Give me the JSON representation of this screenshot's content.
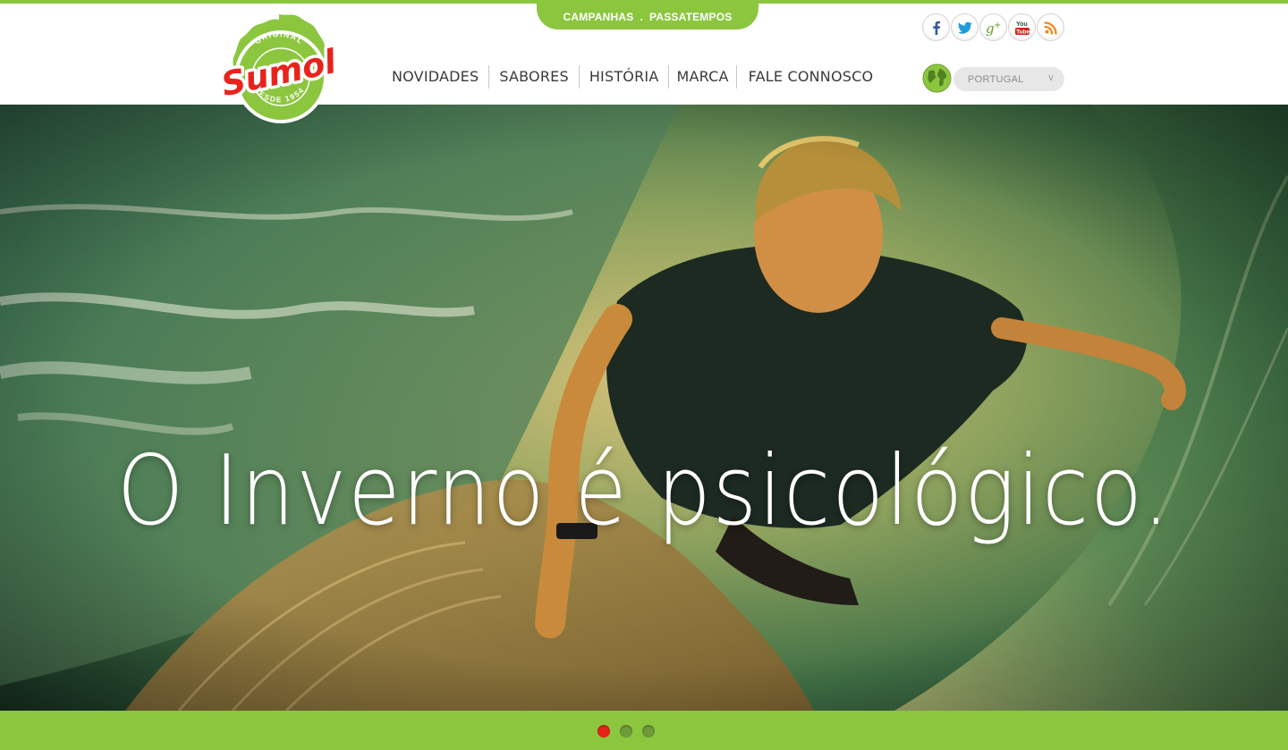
{
  "top_tabs": {
    "campaigns": "CAMPANHAS",
    "separator": ".",
    "contests": "PASSATEMPOS"
  },
  "logo": {
    "top": "ORIGINAL",
    "brand": "Sumol",
    "bottom": "DESDE 1954"
  },
  "nav": [
    "NOVIDADES",
    "SABORES",
    "HISTÓRIA",
    "MARCA",
    "FALE CONNOSCO"
  ],
  "social": [
    {
      "name": "facebook-icon",
      "glyph": "f",
      "color": "#3b5998"
    },
    {
      "name": "twitter-icon",
      "glyph": "t",
      "color": "#1da1f2"
    },
    {
      "name": "google-plus-icon",
      "glyph": "g+",
      "color": "#7ab635"
    },
    {
      "name": "youtube-icon",
      "glyph": "You Tube",
      "color": "#e62117"
    },
    {
      "name": "rss-icon",
      "glyph": "rss",
      "color": "#f39621"
    }
  ],
  "country": {
    "selected": "PORTUGAL",
    "chevron": "v"
  },
  "hero": {
    "headline": "O Inverno é psicológico."
  },
  "slider": {
    "count": 3,
    "active": 0
  },
  "colors": {
    "brand_green": "#8cc63f",
    "brand_red": "#e8231b",
    "nav_text": "#3a3a3a"
  }
}
